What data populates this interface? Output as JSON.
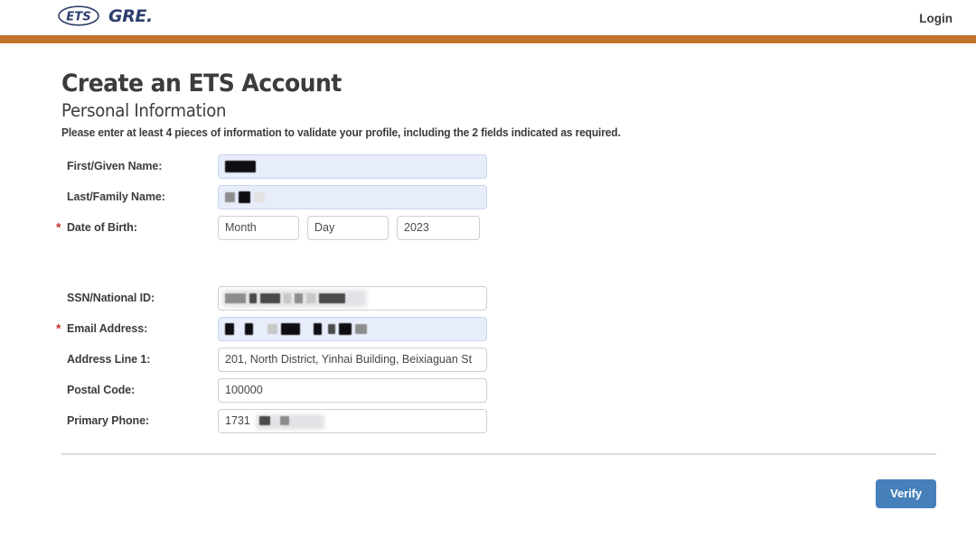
{
  "header": {
    "brand_ets": "ETS",
    "brand_gre": "GRE.",
    "login_label": "Login",
    "accent_bar_color": "#c3742d"
  },
  "page": {
    "title": "Create an ETS Account",
    "section_title": "Personal Information",
    "instructions": "Please enter at least 4 pieces of information to validate your profile, including the 2 fields indicated as required."
  },
  "form": {
    "required_marker": "*",
    "fields": [
      {
        "label": "First/Given Name:",
        "value": "",
        "placeholder": "",
        "required": false,
        "autofilled": true,
        "redacted": true
      },
      {
        "label": "Last/Family Name:",
        "value": "",
        "placeholder": "",
        "required": false,
        "autofilled": true,
        "redacted": true
      },
      {
        "label": "SSN/National ID:",
        "value": "",
        "placeholder": "",
        "required": false,
        "autofilled": false,
        "redacted": true
      },
      {
        "label": "Email Address:",
        "value": "",
        "placeholder": "",
        "required": true,
        "autofilled": true,
        "redacted": true
      },
      {
        "label": "Address Line 1:",
        "value": "201, North District, Yinhai Building, Beixiaguan St",
        "placeholder": "",
        "required": false,
        "autofilled": false,
        "redacted": false
      },
      {
        "label": "Postal Code:",
        "value": "100000",
        "placeholder": "",
        "required": false,
        "autofilled": false,
        "redacted": false
      },
      {
        "label": "Primary Phone:",
        "value": "1731",
        "placeholder": "",
        "required": false,
        "autofilled": false,
        "redacted": true
      }
    ],
    "date_of_birth": {
      "label": "Date of Birth:",
      "required": true,
      "month_placeholder": "Month",
      "day_placeholder": "Day",
      "year_value": "2023"
    }
  },
  "actions": {
    "verify_label": "Verify",
    "verify_color": "#4680bb"
  }
}
